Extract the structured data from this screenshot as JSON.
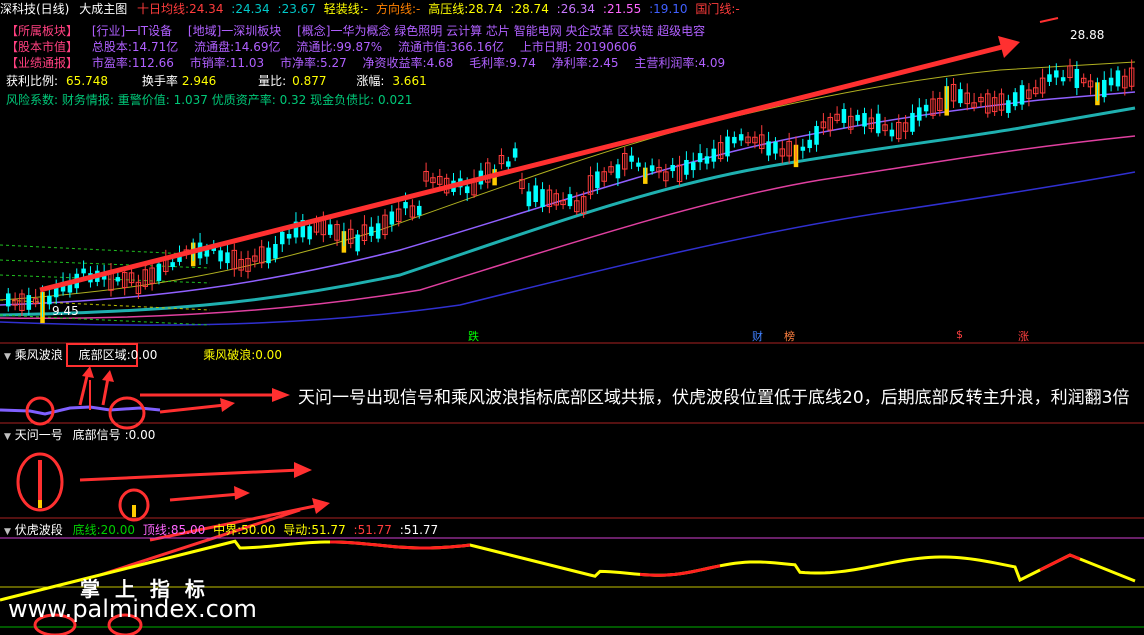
{
  "header": {
    "stock_name": "深科技(日线)",
    "main_chart": "大成主图",
    "ma10_label": "十日均线:",
    "ma10_value": "24.34",
    "v2": "24.34",
    "v3": "23.67",
    "light_label": "轻装线:",
    "light_value": "-",
    "dir_label": "方向线:",
    "dir_value": "-",
    "high_label": "高压线:",
    "high_value": "28.74",
    "v6": "28.74",
    "v7": "26.34",
    "v8": "21.55",
    "v9": "19.10",
    "gate_label": "国门线:",
    "gate_value": "-"
  },
  "info": {
    "row1": {
      "tag": "【所属板块】",
      "industry": "[行业]一IT设备",
      "region": "[地域]一深圳板块",
      "concept": "[概念]一华为概念 绿色照明 云计算 芯片 智能电网 央企改革 区块链 超级电容"
    },
    "row2": {
      "tag": "【股本市值】",
      "total_shares": "总股本:14.71亿",
      "float_shares": "流通盘:14.69亿",
      "float_ratio": "流通比:99.87%",
      "float_value": "流通市值:366.16亿",
      "list_date": "上市日期: 20190606"
    },
    "row3": {
      "tag": "【业绩通报】",
      "pe": "市盈率:112.66",
      "ps": "市销率:11.03",
      "pb": "市净率:5.27",
      "roe": "净资收益率:4.68",
      "gross": "毛利率:9.74",
      "net": "净利率:2.45",
      "main_profit": "主营利润率:4.09"
    },
    "row4": {
      "profit_label": "获利比例:",
      "profit_value": "65.748",
      "turnover_label": "换手率",
      "turnover_value": "2.946",
      "volratio_label": "量比:",
      "volratio_value": "0.877",
      "change_label": "涨幅:",
      "change_value": "3.661"
    },
    "row5": {
      "text": "风险系数: 财务情报: 重警价值: 1.037 优质资产率: 0.32 现金负债比: 0.021"
    }
  },
  "price_labels": {
    "high": "28.88",
    "low": "9.45"
  },
  "markers": [
    "跌",
    "财",
    "榜",
    "$",
    "涨"
  ],
  "panel2": {
    "name": "乘风波浪",
    "bottom_zone": "底部区域:",
    "bottom_value": "0.00",
    "break_label": "乘风破浪:",
    "break_value": "0.00"
  },
  "panel3": {
    "name": "天问一号",
    "signal": "底部信号",
    "signal_value": "0.00"
  },
  "panel4": {
    "name": "伏虎波段",
    "base_label": "底线:",
    "base_value": "20.00",
    "top_label": "顶线:",
    "top_value": "85.00",
    "mid_label": "中界:",
    "mid_value": "50.00",
    "v1_label": "导动:",
    "v1_value": "51.77",
    "v2": "51.77",
    "v3": "51.77"
  },
  "annotation": "天问一号出现信号和乘风波浪指标底部区域共振，伏虎波段位置低于底线20，后期底部反转主升浪，利润翻3倍",
  "watermark": {
    "cn": "掌 上 指 标",
    "url": "www.palmindex.com"
  },
  "colors": {
    "up": "#ff3c3c",
    "down": "#00ffff",
    "annotation": "#ff3030",
    "yellow_bar": "#ffcc00"
  }
}
